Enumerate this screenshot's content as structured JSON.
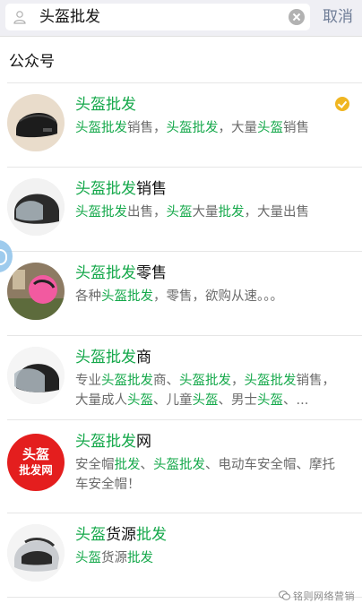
{
  "search": {
    "query": "头盔批发",
    "cancel_label": "取消"
  },
  "section": {
    "title": "公众号"
  },
  "results": [
    {
      "title": [
        [
          "头盔批发",
          true
        ]
      ],
      "desc": [
        [
          "头盔批发",
          true
        ],
        [
          "销售，",
          false
        ],
        [
          "头盔批发",
          true
        ],
        [
          "，大量",
          false
        ],
        [
          "头盔",
          true
        ],
        [
          "销售",
          false
        ]
      ],
      "verified": true,
      "avatar_icon": "black-helmet-avatar"
    },
    {
      "title": [
        [
          "头盔批发",
          true
        ],
        [
          "销售",
          false
        ]
      ],
      "desc": [
        [
          "头盔批发",
          true
        ],
        [
          "出售，",
          false
        ],
        [
          "头盔",
          true
        ],
        [
          "大量",
          false
        ],
        [
          "批发",
          true
        ],
        [
          "，大量出售",
          false
        ]
      ],
      "verified": false,
      "avatar_icon": "matte-helmet-avatar"
    },
    {
      "title": [
        [
          "头盔批发",
          true
        ],
        [
          "零售",
          false
        ]
      ],
      "desc": [
        [
          "各种",
          false
        ],
        [
          "头盔批发",
          true
        ],
        [
          "，零售，欲购从速。。。",
          false
        ]
      ],
      "verified": false,
      "avatar_icon": "pink-helmet-avatar"
    },
    {
      "title": [
        [
          "头盔批发",
          true
        ],
        [
          "商",
          false
        ]
      ],
      "desc": [
        [
          "专业",
          false
        ],
        [
          "头盔批发",
          true
        ],
        [
          "商、",
          false
        ],
        [
          "头盔批发",
          true
        ],
        [
          "，",
          false
        ],
        [
          "头盔批发",
          true
        ],
        [
          "销售，大量成人",
          false
        ],
        [
          "头盔",
          true
        ],
        [
          "、儿童",
          false
        ],
        [
          "头盔",
          true
        ],
        [
          "、男士",
          false
        ],
        [
          "头盔",
          true
        ],
        [
          "、...",
          false
        ]
      ],
      "verified": false,
      "avatar_icon": "visor-helmet-avatar"
    },
    {
      "title": [
        [
          "头盔批发",
          true
        ],
        [
          "网",
          false
        ]
      ],
      "desc": [
        [
          "安全帽",
          false
        ],
        [
          "批发",
          true
        ],
        [
          "、",
          false
        ],
        [
          "头盔批发",
          true
        ],
        [
          "、电动车安全帽、摩托车安全帽！",
          false
        ]
      ],
      "verified": false,
      "avatar_icon": "red-logo-avatar",
      "avatar_text": [
        "头盔",
        "批发网"
      ]
    },
    {
      "title": [
        [
          "头盔",
          true
        ],
        [
          "货源",
          false
        ],
        [
          "批发",
          true
        ]
      ],
      "desc": [
        [
          "头盔",
          true
        ],
        [
          "货源",
          false
        ],
        [
          "批发",
          true
        ]
      ],
      "verified": false,
      "avatar_icon": "silver-helmet-avatar"
    }
  ],
  "watermark": "铭则网络营销",
  "colors": {
    "highlight": "#14a84a",
    "cancel": "#6e7c96",
    "verified": "#f0b622"
  }
}
